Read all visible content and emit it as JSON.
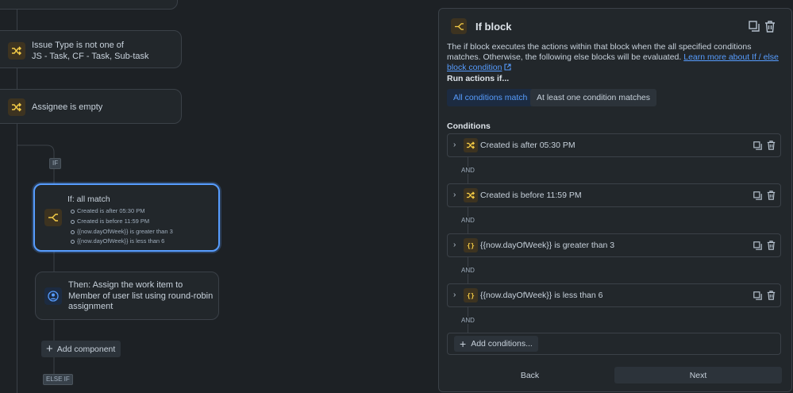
{
  "flow": {
    "issue_type_card": {
      "line1": "Issue Type is not one of",
      "line2": "JS - Task, CF - Task, Sub-task"
    },
    "assignee_card": {
      "label": "Assignee is empty"
    },
    "if_tag": "IF",
    "if_block_card": {
      "title": "If: all match",
      "conditions": [
        "Created is after 05:30 PM",
        "Created is before 11:59 PM",
        "{{now.dayOfWeek}} is greater than 3",
        "{{now.dayOfWeek}} is less than 6"
      ]
    },
    "then_card": {
      "line1": "Then: Assign the work item to",
      "line2": "Member of user list using round-robin",
      "line3": "assignment"
    },
    "add_component_label": "Add component",
    "else_if_tag": "ELSE IF"
  },
  "panel": {
    "title": "If block",
    "description": "The if block executes the actions within that block when the all specified conditions matches. Otherwise, the following else blocks will be evaluated.",
    "learn_more_link": "Learn more about If / else block condition",
    "run_actions_label": "Run actions if...",
    "options": [
      {
        "label": "All conditions match",
        "selected": true
      },
      {
        "label": "At least one condition matches",
        "selected": false
      }
    ],
    "conditions_label": "Conditions",
    "conditions": [
      {
        "icon": "shuffle-icon",
        "text": "Created is after 05:30 PM"
      },
      {
        "icon": "shuffle-icon",
        "text": "Created is before 11:59 PM"
      },
      {
        "icon": "braces-icon",
        "text": "{{now.dayOfWeek}} is greater than 3"
      },
      {
        "icon": "braces-icon",
        "text": "{{now.dayOfWeek}} is less than 6"
      }
    ],
    "and_label": "AND",
    "add_conditions_label": "Add conditions...",
    "back_label": "Back",
    "next_label": "Next"
  },
  "colors": {
    "background": "#1d2125",
    "accent_yellow": "#f5cd47",
    "selected_blue": "#579dff",
    "highlight_border": "#579dff"
  }
}
